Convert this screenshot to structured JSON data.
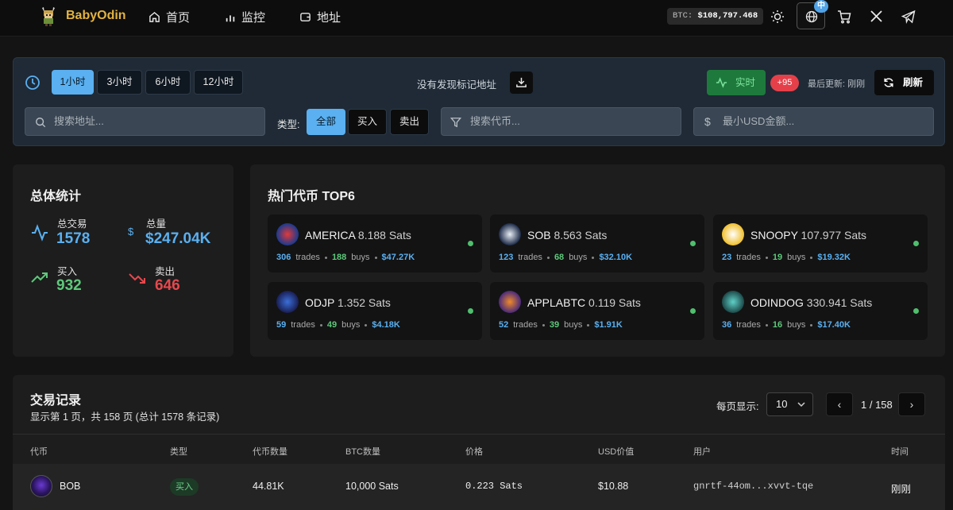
{
  "nav": {
    "brand": "BabyOdin",
    "links": [
      {
        "label": "首页",
        "icon": "home-icon"
      },
      {
        "label": "监控",
        "icon": "bar-chart-icon"
      },
      {
        "label": "地址",
        "icon": "wallet-icon"
      }
    ],
    "btc_label": "BTC:",
    "btc_price": "$108,797.468",
    "lang_badge": "中"
  },
  "filters": {
    "time_buttons": [
      "1小时",
      "3小时",
      "6小时",
      "12小时"
    ],
    "no_marked": "没有发现标记地址",
    "live_label": "实时",
    "new_count": "+95",
    "last_update": "最后更新: 刚刚",
    "refresh_label": "刷新",
    "search_address_placeholder": "搜索地址...",
    "type_label": "类型:",
    "type_buttons": [
      "全部",
      "买入",
      "卖出"
    ],
    "search_token_placeholder": "搜索代币...",
    "min_usd_placeholder": "最小USD金额...",
    "active_color": "#5ab0f0"
  },
  "stats": {
    "title": "总体统计",
    "total_trades_label": "总交易",
    "total_trades": "1578",
    "volume_label": "总量",
    "volume": "$247.04K",
    "buys_label": "买入",
    "buys": "932",
    "sells_label": "卖出",
    "sells": "646"
  },
  "hot": {
    "title": "热门代币 TOP6",
    "trades_word": "trades",
    "buys_word": "buys",
    "tokens": [
      {
        "name": "AMERICA",
        "price": "8.188 Sats",
        "trades": "306",
        "buys": "188",
        "volume": "$47.27K"
      },
      {
        "name": "SOB",
        "price": "8.563 Sats",
        "trades": "123",
        "buys": "68",
        "volume": "$32.10K"
      },
      {
        "name": "SNOOPY",
        "price": "107.977 Sats",
        "trades": "23",
        "buys": "19",
        "volume": "$19.32K"
      },
      {
        "name": "ODJP",
        "price": "1.352 Sats",
        "trades": "59",
        "buys": "49",
        "volume": "$4.18K"
      },
      {
        "name": "APPLABTC",
        "price": "0.119 Sats",
        "trades": "52",
        "buys": "39",
        "volume": "$1.91K"
      },
      {
        "name": "ODINDOG",
        "price": "330.941 Sats",
        "trades": "36",
        "buys": "16",
        "volume": "$17.40K"
      }
    ]
  },
  "trades": {
    "title": "交易记录",
    "subtitle": "显示第 1 页，共 158 页 (总计 1578 条记录)",
    "per_page_label": "每页显示:",
    "per_page": "10",
    "prev": "‹",
    "next": "›",
    "page": "1 / 158",
    "columns": [
      "代币",
      "类型",
      "代币数量",
      "BTC数量",
      "价格",
      "USD价值",
      "用户",
      "时间"
    ],
    "rows": [
      {
        "token": "BOB",
        "type": "买入",
        "amount": "44.81K",
        "btc": "10,000 Sats",
        "price": "0.223 Sats",
        "usd": "$10.88",
        "user": "gnrtf-44om...xvvt-tqe",
        "time": "刚刚"
      }
    ]
  }
}
